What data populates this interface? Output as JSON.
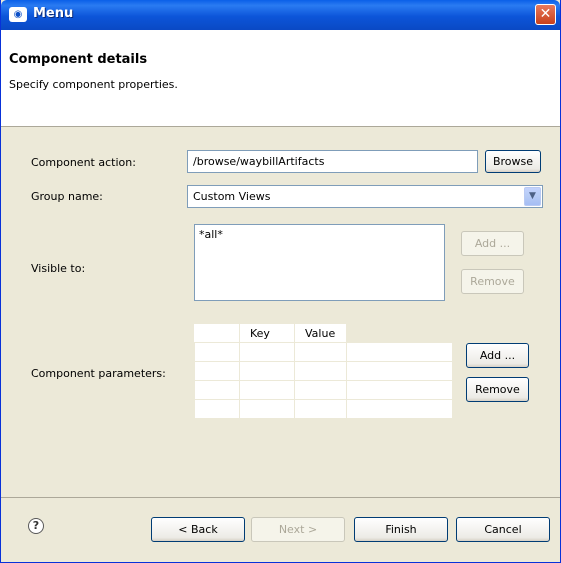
{
  "window": {
    "title": "Menu",
    "close_glyph": "✕",
    "icon": "app-logo-icon"
  },
  "header": {
    "title": "Component details",
    "description": "Specify component properties."
  },
  "form": {
    "component_action": {
      "label": "Component action:",
      "value": "/browse/waybillArtifacts",
      "browse_button": "Browse"
    },
    "group_name": {
      "label": "Group name:",
      "value": "Custom Views",
      "arrow_glyph": "▼"
    },
    "visible_to": {
      "label": "Visible to:",
      "items": [
        "*all*"
      ],
      "add_button": "Add ...",
      "remove_button": "Remove"
    },
    "component_parameters": {
      "label": "Component parameters:",
      "columns": [
        "",
        "Key",
        "Value"
      ],
      "rows": [
        [
          "",
          "",
          ""
        ],
        [
          "",
          "",
          ""
        ],
        [
          "",
          "",
          ""
        ],
        [
          "",
          "",
          ""
        ]
      ],
      "add_button": "Add ...",
      "remove_button": "Remove"
    }
  },
  "footer": {
    "help_glyph": "?",
    "back": "< Back",
    "next": "Next >",
    "finish": "Finish",
    "cancel": "Cancel"
  }
}
